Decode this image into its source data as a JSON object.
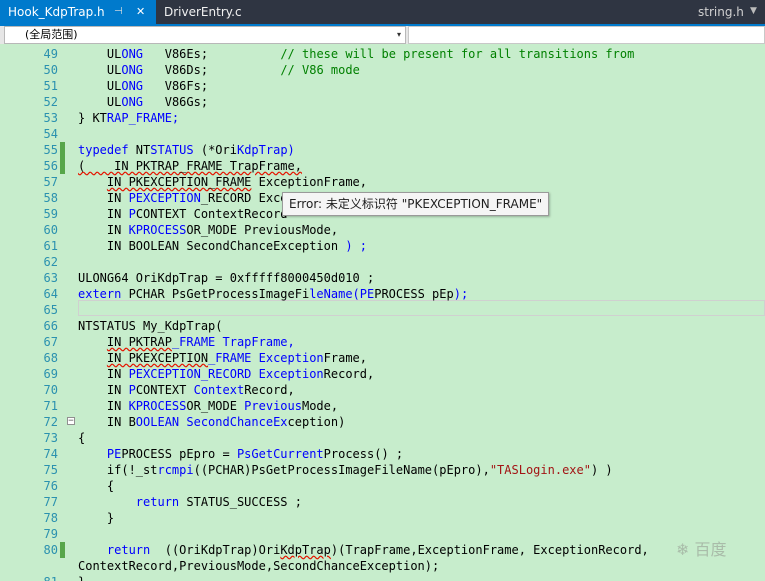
{
  "tabs": [
    {
      "label": "Hook_KdpTrap.h",
      "pin": "⊣",
      "close": "✕"
    },
    {
      "label": "DriverEntry.c"
    }
  ],
  "right_tab": {
    "label": "string.h",
    "dropdown": "▼"
  },
  "navbar": {
    "scope": "(全局范围)",
    "dropdown": "▾"
  },
  "tooltip": "Error: 未定义标识符 \"PKEXCEPTION_FRAME\"",
  "watermark": "❄ 百度",
  "lines": [
    {
      "n": "49",
      "chg": false,
      "fold": "",
      "parts": [
        {
          "t": "    UL"
        },
        {
          "t": "ONG",
          "c": "kw"
        },
        {
          "t": "   V86Es;          "
        },
        {
          "t": "// these will be present for all transitions from",
          "c": "cmt"
        }
      ]
    },
    {
      "n": "50",
      "chg": false,
      "fold": "",
      "parts": [
        {
          "t": "    UL"
        },
        {
          "t": "ONG",
          "c": "kw"
        },
        {
          "t": "   V86Ds;          "
        },
        {
          "t": "// V86 mode",
          "c": "cmt"
        }
      ]
    },
    {
      "n": "51",
      "chg": false,
      "fold": "",
      "parts": [
        {
          "t": "    UL"
        },
        {
          "t": "ONG",
          "c": "kw"
        },
        {
          "t": "   V86Fs;"
        }
      ]
    },
    {
      "n": "52",
      "chg": false,
      "fold": "",
      "parts": [
        {
          "t": "    UL"
        },
        {
          "t": "ONG",
          "c": "kw"
        },
        {
          "t": "   V86Gs;"
        }
      ]
    },
    {
      "n": "53",
      "chg": false,
      "fold": "",
      "parts": [
        {
          "t": "} KT"
        },
        {
          "t": "RAP_FRAME;",
          "c": "kw"
        }
      ]
    },
    {
      "n": "54",
      "chg": false,
      "fold": "",
      "parts": [
        {
          "t": ""
        }
      ]
    },
    {
      "n": "55",
      "chg": true,
      "fold": "",
      "parts": [
        {
          "t": "typedef",
          "c": "kw"
        },
        {
          "t": " NT"
        },
        {
          "t": "STATUS",
          "c": "kw"
        },
        {
          "t": " (*Ori"
        },
        {
          "t": "KdpTrap)",
          "c": "kw"
        }
      ]
    },
    {
      "n": "56",
      "chg": true,
      "fold": "",
      "parts": [
        {
          "t": "(    IN PKTRAP_FRAME TrapFrame,",
          "c": "sq"
        }
      ]
    },
    {
      "n": "57",
      "chg": false,
      "fold": "",
      "parts": [
        {
          "t": "    "
        },
        {
          "t": "IN PKEXCEPTION_FRAME",
          "c": "sq"
        },
        {
          "t": " ExceptionFrame,"
        }
      ]
    },
    {
      "n": "58",
      "chg": false,
      "fold": "",
      "parts": [
        {
          "t": "    IN "
        },
        {
          "t": "PEXCEPTION",
          "c": "kw"
        },
        {
          "t": "_RECORD Exce"
        }
      ]
    },
    {
      "n": "59",
      "chg": false,
      "fold": "",
      "parts": [
        {
          "t": "    IN "
        },
        {
          "t": "P",
          "c": "kw"
        },
        {
          "t": "CONTEXT ContextRecord"
        }
      ]
    },
    {
      "n": "60",
      "chg": false,
      "fold": "",
      "parts": [
        {
          "t": "    IN "
        },
        {
          "t": "KPROCESS",
          "c": "kw"
        },
        {
          "t": "OR_MODE PreviousMode,"
        }
      ]
    },
    {
      "n": "61",
      "chg": false,
      "fold": "",
      "parts": [
        {
          "t": "    IN BOOLEAN SecondChanceException "
        },
        {
          "t": ") ;",
          "c": "kw"
        }
      ]
    },
    {
      "n": "62",
      "chg": false,
      "fold": "",
      "parts": [
        {
          "t": ""
        }
      ]
    },
    {
      "n": "63",
      "chg": false,
      "fold": "",
      "parts": [
        {
          "t": "ULONG64 OriKdpTrap = 0xfffff8000450d010 ;"
        }
      ]
    },
    {
      "n": "64",
      "chg": false,
      "fold": "",
      "parts": [
        {
          "t": "extern",
          "c": "kw"
        },
        {
          "t": " PCHAR PsGetProcessImageFi"
        },
        {
          "t": "leName(PE",
          "c": "kw"
        },
        {
          "t": "PROCESS pEp"
        },
        {
          "t": ");",
          "c": "kw"
        }
      ]
    },
    {
      "n": "65",
      "chg": false,
      "fold": "",
      "parts": [
        {
          "t": ""
        }
      ]
    },
    {
      "n": "66",
      "chg": false,
      "fold": "",
      "parts": [
        {
          "t": "NTSTATUS My_KdpTrap("
        }
      ]
    },
    {
      "n": "67",
      "chg": false,
      "fold": "",
      "parts": [
        {
          "t": "    "
        },
        {
          "t": "IN PKTRAP",
          "c": "sq"
        },
        {
          "t": "_FRAME TrapFrame,",
          "c": "kw"
        }
      ]
    },
    {
      "n": "68",
      "chg": false,
      "fold": "",
      "parts": [
        {
          "t": "    "
        },
        {
          "t": "IN PKEXCEPTION",
          "c": "sq"
        },
        {
          "t": "_FRAME Exception",
          "c": "kw"
        },
        {
          "t": "Frame,"
        }
      ]
    },
    {
      "n": "69",
      "chg": false,
      "fold": "",
      "parts": [
        {
          "t": "    IN "
        },
        {
          "t": "PEXCEPTION_RECORD Exception",
          "c": "kw"
        },
        {
          "t": "Record,"
        }
      ]
    },
    {
      "n": "70",
      "chg": false,
      "fold": "",
      "parts": [
        {
          "t": "    IN "
        },
        {
          "t": "P",
          "c": "kw"
        },
        {
          "t": "CONTEXT "
        },
        {
          "t": "Context",
          "c": "kw"
        },
        {
          "t": "Record,"
        }
      ]
    },
    {
      "n": "71",
      "chg": false,
      "fold": "",
      "parts": [
        {
          "t": "    IN "
        },
        {
          "t": "KPROCESS",
          "c": "kw"
        },
        {
          "t": "OR_MODE "
        },
        {
          "t": "Previous",
          "c": "kw"
        },
        {
          "t": "Mode,"
        }
      ]
    },
    {
      "n": "72",
      "chg": false,
      "fold": "⊟",
      "parts": [
        {
          "t": "    IN B"
        },
        {
          "t": "OOLEAN SecondChanceEx",
          "c": "kw"
        },
        {
          "t": "ception)"
        }
      ]
    },
    {
      "n": "73",
      "chg": false,
      "fold": "",
      "parts": [
        {
          "t": "{"
        }
      ]
    },
    {
      "n": "74",
      "chg": false,
      "fold": "",
      "parts": [
        {
          "t": "    "
        },
        {
          "t": "PE",
          "c": "kw"
        },
        {
          "t": "PROCESS pEpro = "
        },
        {
          "t": "PsGetCurrent",
          "c": "kw"
        },
        {
          "t": "Process() ;"
        }
      ]
    },
    {
      "n": "75",
      "chg": false,
      "fold": "",
      "parts": [
        {
          "t": "    if(!_st"
        },
        {
          "t": "rcmpi",
          "c": "kw"
        },
        {
          "t": "((PCHAR)PsGetProcessImageFileName(pEpro),"
        },
        {
          "t": "\"TASLogin.exe\"",
          "c": "str"
        },
        {
          "t": ") )"
        }
      ]
    },
    {
      "n": "76",
      "chg": false,
      "fold": "",
      "parts": [
        {
          "t": "    {"
        }
      ]
    },
    {
      "n": "77",
      "chg": false,
      "fold": "",
      "parts": [
        {
          "t": "        "
        },
        {
          "t": "return",
          "c": "kw"
        },
        {
          "t": " STATUS_SUCCESS ;"
        }
      ]
    },
    {
      "n": "78",
      "chg": false,
      "fold": "",
      "parts": [
        {
          "t": "    }"
        }
      ]
    },
    {
      "n": "79",
      "chg": false,
      "fold": "",
      "parts": [
        {
          "t": ""
        }
      ]
    },
    {
      "n": "80",
      "chg": true,
      "fold": "",
      "parts": [
        {
          "t": "    "
        },
        {
          "t": "return",
          "c": "kw"
        },
        {
          "t": "  ((OriKdpTrap)Ori"
        },
        {
          "t": "KdpTrap",
          "c": "sq"
        },
        {
          "t": ")(TrapFrame,ExceptionFrame, ExceptionRecord,"
        }
      ]
    },
    {
      "n": "",
      "chg": false,
      "fold": "",
      "parts": [
        {
          "t": "ContextRecord,PreviousMode,SecondChanceException);"
        }
      ]
    },
    {
      "n": "81",
      "chg": false,
      "fold": "",
      "parts": [
        {
          "t": "}"
        }
      ]
    }
  ]
}
